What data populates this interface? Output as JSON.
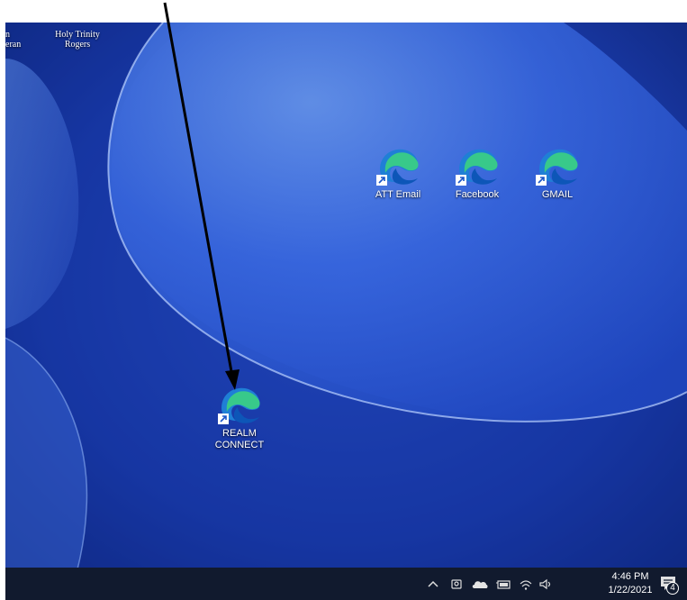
{
  "desktop": {
    "top_icons": [
      {
        "label_line1": "n",
        "label_line2": "eran"
      },
      {
        "label_line1": "Holy Trinity",
        "label_line2": "Rogers"
      }
    ],
    "shortcuts": [
      {
        "label": "ATT Email",
        "icon": "edge-icon"
      },
      {
        "label": "Facebook",
        "icon": "edge-icon"
      },
      {
        "label": "GMAIL",
        "icon": "edge-icon"
      },
      {
        "label": "REALM CONNECT",
        "icon": "edge-icon"
      }
    ]
  },
  "taskbar": {
    "tray_icons": [
      "chevron-up-icon",
      "meet-now-icon",
      "onedrive-icon",
      "battery-icon",
      "wifi-icon",
      "volume-icon"
    ],
    "time": "4:46 PM",
    "date": "1/22/2021",
    "notification_count": "4"
  },
  "annotation": {
    "type": "arrow",
    "color": "#000000"
  }
}
